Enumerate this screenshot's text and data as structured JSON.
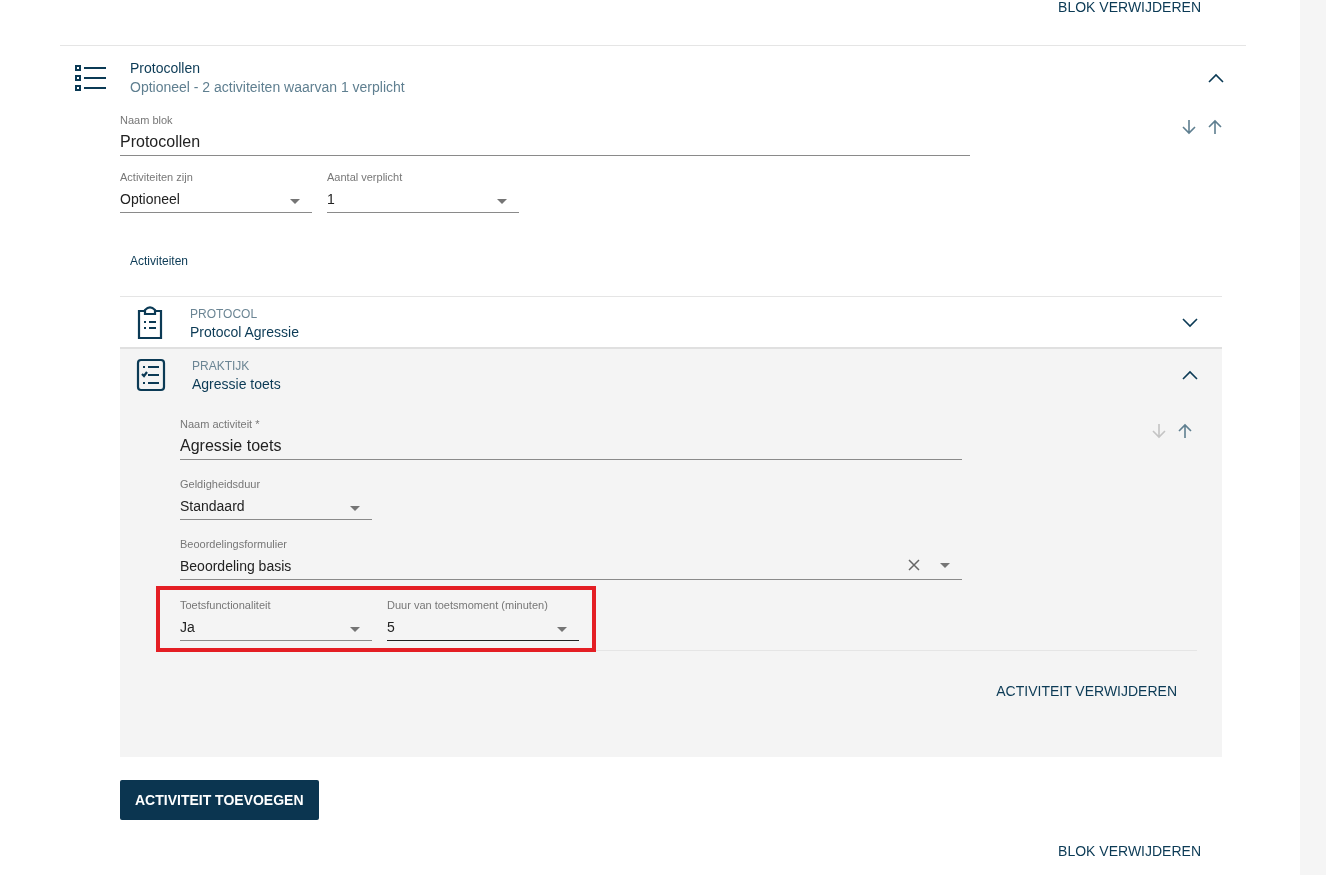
{
  "top_action": "BLOK VERWIJDEREN",
  "block": {
    "title": "Protocollen",
    "subtitle": "Optioneel - 2 activiteiten waarvan 1 verplicht",
    "expanded": true,
    "move": {
      "down_disabled": false,
      "up_disabled": false
    },
    "name_field": {
      "label": "Naam blok",
      "value": "Protocollen"
    },
    "selects": [
      {
        "label": "Activiteiten zijn",
        "value": "Optioneel"
      },
      {
        "label": "Aantal verplicht",
        "value": "1"
      }
    ],
    "activities_heading": "Activiteiten",
    "activities": [
      {
        "kind": "clipboard",
        "type": "PROTOCOL",
        "title": "Protocol Agressie",
        "expanded": false
      },
      {
        "kind": "checklist",
        "type": "PRAKTIJK",
        "title": "Agressie toets",
        "expanded": true,
        "move": {
          "down_disabled": true,
          "up_disabled": false
        },
        "fields": [
          {
            "kind": "text",
            "label": "Naam activiteit *",
            "value": "Agressie toets"
          },
          {
            "kind": "select",
            "label": "Geldigheidsduur",
            "value": "Standaard",
            "clearable": false
          },
          {
            "kind": "select_wide",
            "label": "Beoordelingsformulier",
            "value": "Beoordeling basis",
            "clearable": true
          }
        ],
        "highlighted_fields": {
          "highlighted": true,
          "fields": [
            {
              "label": "Toetsfunctionaliteit",
              "value": "Ja",
              "focused": false
            },
            {
              "label": "Duur van toetsmoment (minuten)",
              "value": "5",
              "focused": true
            }
          ]
        },
        "delete_action": "ACTIVITEIT VERWIJDEREN"
      }
    ],
    "add_button": "ACTIVITEIT TOEVOEGEN",
    "delete_action": "BLOK VERWIJDEREN"
  }
}
